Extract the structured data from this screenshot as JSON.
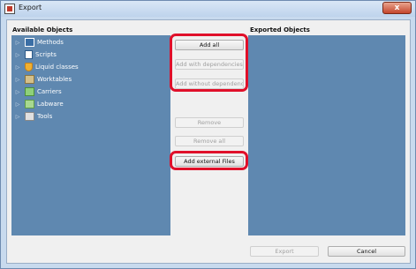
{
  "window": {
    "title": "Export",
    "close_label": "x"
  },
  "available_panel": {
    "title": "Available Objects",
    "items": [
      {
        "label": "Methods",
        "icon": "methods-icon"
      },
      {
        "label": "Scripts",
        "icon": "scripts-icon"
      },
      {
        "label": "Liquid classes",
        "icon": "liquid-classes-icon"
      },
      {
        "label": "Worktables",
        "icon": "worktables-icon"
      },
      {
        "label": "Carriers",
        "icon": "carriers-icon"
      },
      {
        "label": "Labware",
        "icon": "labware-icon"
      },
      {
        "label": "Tools",
        "icon": "tools-icon"
      }
    ]
  },
  "exported_panel": {
    "title": "Exported Objects"
  },
  "buttons": {
    "add_all": "Add all",
    "add_with_dependencies": "Add with dependencies",
    "add_without_dependencies": "Add without dependencies",
    "remove": "Remove",
    "remove_all": "Remove all",
    "add_external_files": "Add external Files",
    "export": "Export",
    "cancel": "Cancel"
  },
  "colors": {
    "panel_bg": "#5f88b0",
    "highlight": "#e0102a"
  }
}
